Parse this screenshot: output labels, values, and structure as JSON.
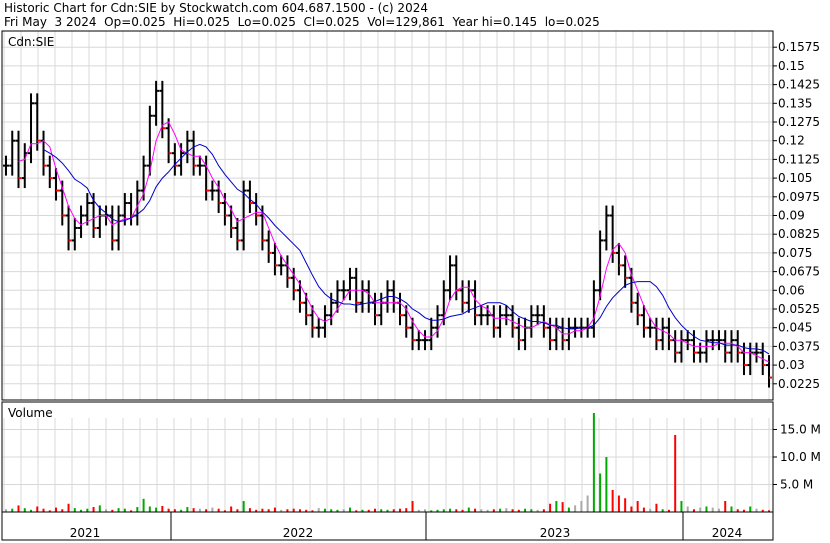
{
  "header": {
    "line1": "Historic Chart for Cdn:SIE by Stockwatch.com 604.687.1500 - (c) 2024",
    "line2": "Fri May  3 2024  Op=0.025  Hi=0.025  Lo=0.025  Cl=0.025  Vol=129,861  Year hi=0.145  lo=0.025"
  },
  "chart_data": [
    {
      "type": "line",
      "subtype": "ohlc-bars-with-moving-averages",
      "symbol_label": "Cdn:SIE",
      "y_ticks": [
        "0.1575",
        "0.15",
        "0.1425",
        "0.135",
        "0.1275",
        "0.12",
        "0.1125",
        "0.105",
        "0.0975",
        "0.09",
        "0.0825",
        "0.075",
        "0.0675",
        "0.06",
        "0.0525",
        "0.045",
        "0.0375",
        "0.03",
        "0.0225"
      ],
      "ylim": [
        0.016,
        0.164
      ],
      "x_ticks": [
        "2021",
        "2022",
        "2023",
        "2024"
      ],
      "grid": true,
      "colors": {
        "price": "#000000",
        "down": "#ff0000",
        "ma_short": "#ff00ff",
        "ma_long": "#0000cc"
      },
      "series": [
        {
          "role": "close",
          "values": [
            0.11,
            0.12,
            0.105,
            0.115,
            0.135,
            0.12,
            0.11,
            0.105,
            0.1,
            0.09,
            0.08,
            0.085,
            0.09,
            0.095,
            0.085,
            0.09,
            0.09,
            0.08,
            0.09,
            0.095,
            0.09,
            0.1,
            0.11,
            0.13,
            0.14,
            0.125,
            0.115,
            0.11,
            0.115,
            0.12,
            0.11,
            0.11,
            0.1,
            0.1,
            0.095,
            0.09,
            0.085,
            0.08,
            0.1,
            0.095,
            0.09,
            0.08,
            0.075,
            0.07,
            0.07,
            0.065,
            0.06,
            0.055,
            0.05,
            0.045,
            0.045,
            0.05,
            0.055,
            0.06,
            0.06,
            0.065,
            0.055,
            0.06,
            0.055,
            0.05,
            0.055,
            0.06,
            0.055,
            0.05,
            0.045,
            0.04,
            0.04,
            0.04,
            0.045,
            0.05,
            0.06,
            0.07,
            0.06,
            0.055,
            0.06,
            0.05,
            0.05,
            0.05,
            0.045,
            0.05,
            0.05,
            0.045,
            0.04,
            0.045,
            0.05,
            0.05,
            0.045,
            0.04,
            0.045,
            0.04,
            0.045,
            0.045,
            0.045,
            0.045,
            0.06,
            0.08,
            0.09,
            0.075,
            0.07,
            0.065,
            0.055,
            0.05,
            0.045,
            0.045,
            0.04,
            0.045,
            0.04,
            0.035,
            0.04,
            0.04,
            0.035,
            0.035,
            0.04,
            0.04,
            0.04,
            0.035,
            0.04,
            0.035,
            0.03,
            0.035,
            0.035,
            0.03,
            0.025
          ]
        },
        {
          "role": "volume_millions",
          "values": [
            0.5,
            0.6,
            1.2,
            0.7,
            0.4,
            1.0,
            0.6,
            0.3,
            0.8,
            0.5,
            1.5,
            0.7,
            0.4,
            0.6,
            0.9,
            1.2,
            0.5,
            0.4,
            0.7,
            0.6,
            0.3,
            0.9,
            2.4,
            1.0,
            0.8,
            1.1,
            0.6,
            0.5,
            0.4,
            0.9,
            0.7,
            0.6,
            0.5,
            0.8,
            0.6,
            0.3,
            1.0,
            0.5,
            2.0,
            0.7,
            0.4,
            0.6,
            0.5,
            0.8,
            0.4,
            0.5,
            0.6,
            0.5,
            0.4,
            0.3,
            0.7,
            0.6,
            0.5,
            0.4,
            0.5,
            0.8,
            0.3,
            0.4,
            0.4,
            0.6,
            0.5,
            0.4,
            0.5,
            0.6,
            0.7,
            2.0,
            0.4,
            0.5,
            0.3,
            0.4,
            0.5,
            0.6,
            0.5,
            0.4,
            0.8,
            0.6,
            0.5,
            0.4,
            0.5,
            0.6,
            0.7,
            0.5,
            0.4,
            0.6,
            0.5,
            0.4,
            0.5,
            1.5,
            2.0,
            1.8,
            0.8,
            1.2,
            2.0,
            3.0,
            18.0,
            7.0,
            10.0,
            4.0,
            3.0,
            2.5,
            1.0,
            2.0,
            0.8,
            0.6,
            1.5,
            0.5,
            0.4,
            14.0,
            2.0,
            1.0,
            0.5,
            0.8,
            1.0,
            0.8,
            0.6,
            2.0,
            1.0,
            0.5,
            0.4,
            1.0,
            0.6,
            0.4,
            0.3
          ]
        }
      ]
    },
    {
      "type": "bar",
      "title": "Volume",
      "y_ticks": [
        "15.0 M",
        "10.0 M",
        "5.0 M"
      ],
      "ylim": [
        0,
        20
      ]
    }
  ]
}
